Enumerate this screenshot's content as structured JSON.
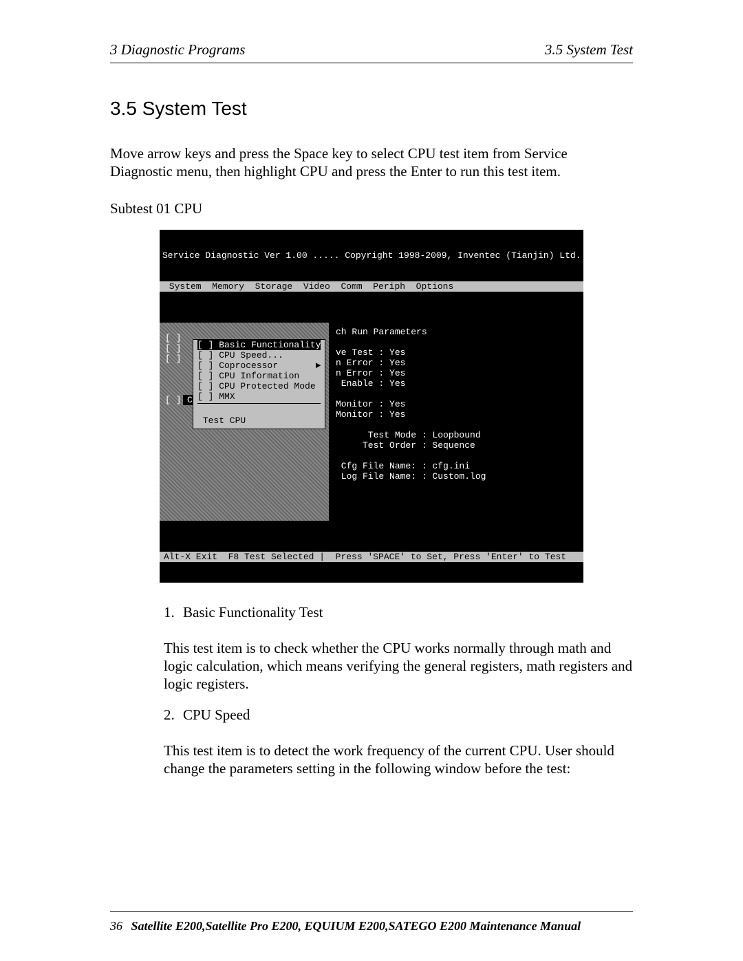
{
  "header": {
    "left": "3  Diagnostic Programs",
    "right": "3.5 System Test"
  },
  "section": {
    "title": "3.5    System Test",
    "intro": "Move arrow keys and press the Space key to select CPU test item from Service Diagnostic menu, then highlight CPU and press the Enter  to run this test item.",
    "subtest_label": "Subtest 01 CPU"
  },
  "dos": {
    "top": "Service Diagnostic Ver 1.00 ..... Copyright 1998-2009, Inventec (Tianjin) Ltd.",
    "menubar": " System  Memory  Storage  Video  Comm  Periph  Options",
    "left_markers": "[ ]\n[ ]\n[ ]",
    "cpu_row": {
      "marker": "[ ]",
      "label": "CPU",
      "arrow": "►"
    },
    "dropdown": {
      "items": [
        "[ ] Basic Functionality",
        "[ ] CPU Speed...",
        "[ ] Coprocessor       ►",
        "[ ] CPU Information",
        "[ ] CPU Protected Mode",
        "[ ] MMX"
      ],
      "footer": " Test CPU"
    },
    "panel_title": "ch Run Parameters",
    "panel_lines": "ve Test : Yes\nn Error : Yes\nn Error : Yes\n Enable : Yes\n\nMonitor : Yes\nMonitor : Yes\n\n      Test Mode : Loopbound\n     Test Order : Sequence\n\n Cfg File Name: : cfg.ini\n Log File Name: : Custom.log",
    "status": "Alt-X Exit  F8 Test Selected |  Press 'SPACE' to Set, Press 'Enter' to Test"
  },
  "list": {
    "items": [
      {
        "num": "1.",
        "title": "Basic Functionality Test",
        "desc": "This test item is to check whether the CPU works normally through math and logic calculation, which means verifying the general registers, math registers and logic registers."
      },
      {
        "num": "2.",
        "title": "CPU Speed",
        "desc": "This test item is to detect the work frequency of the current CPU. User should change the parameters setting in the following window before the test:"
      }
    ]
  },
  "footer": {
    "pagenum": "36",
    "title": "Satellite E200,Satellite Pro E200, EQUIUM E200,SATEGO E200 Maintenance Manual"
  }
}
